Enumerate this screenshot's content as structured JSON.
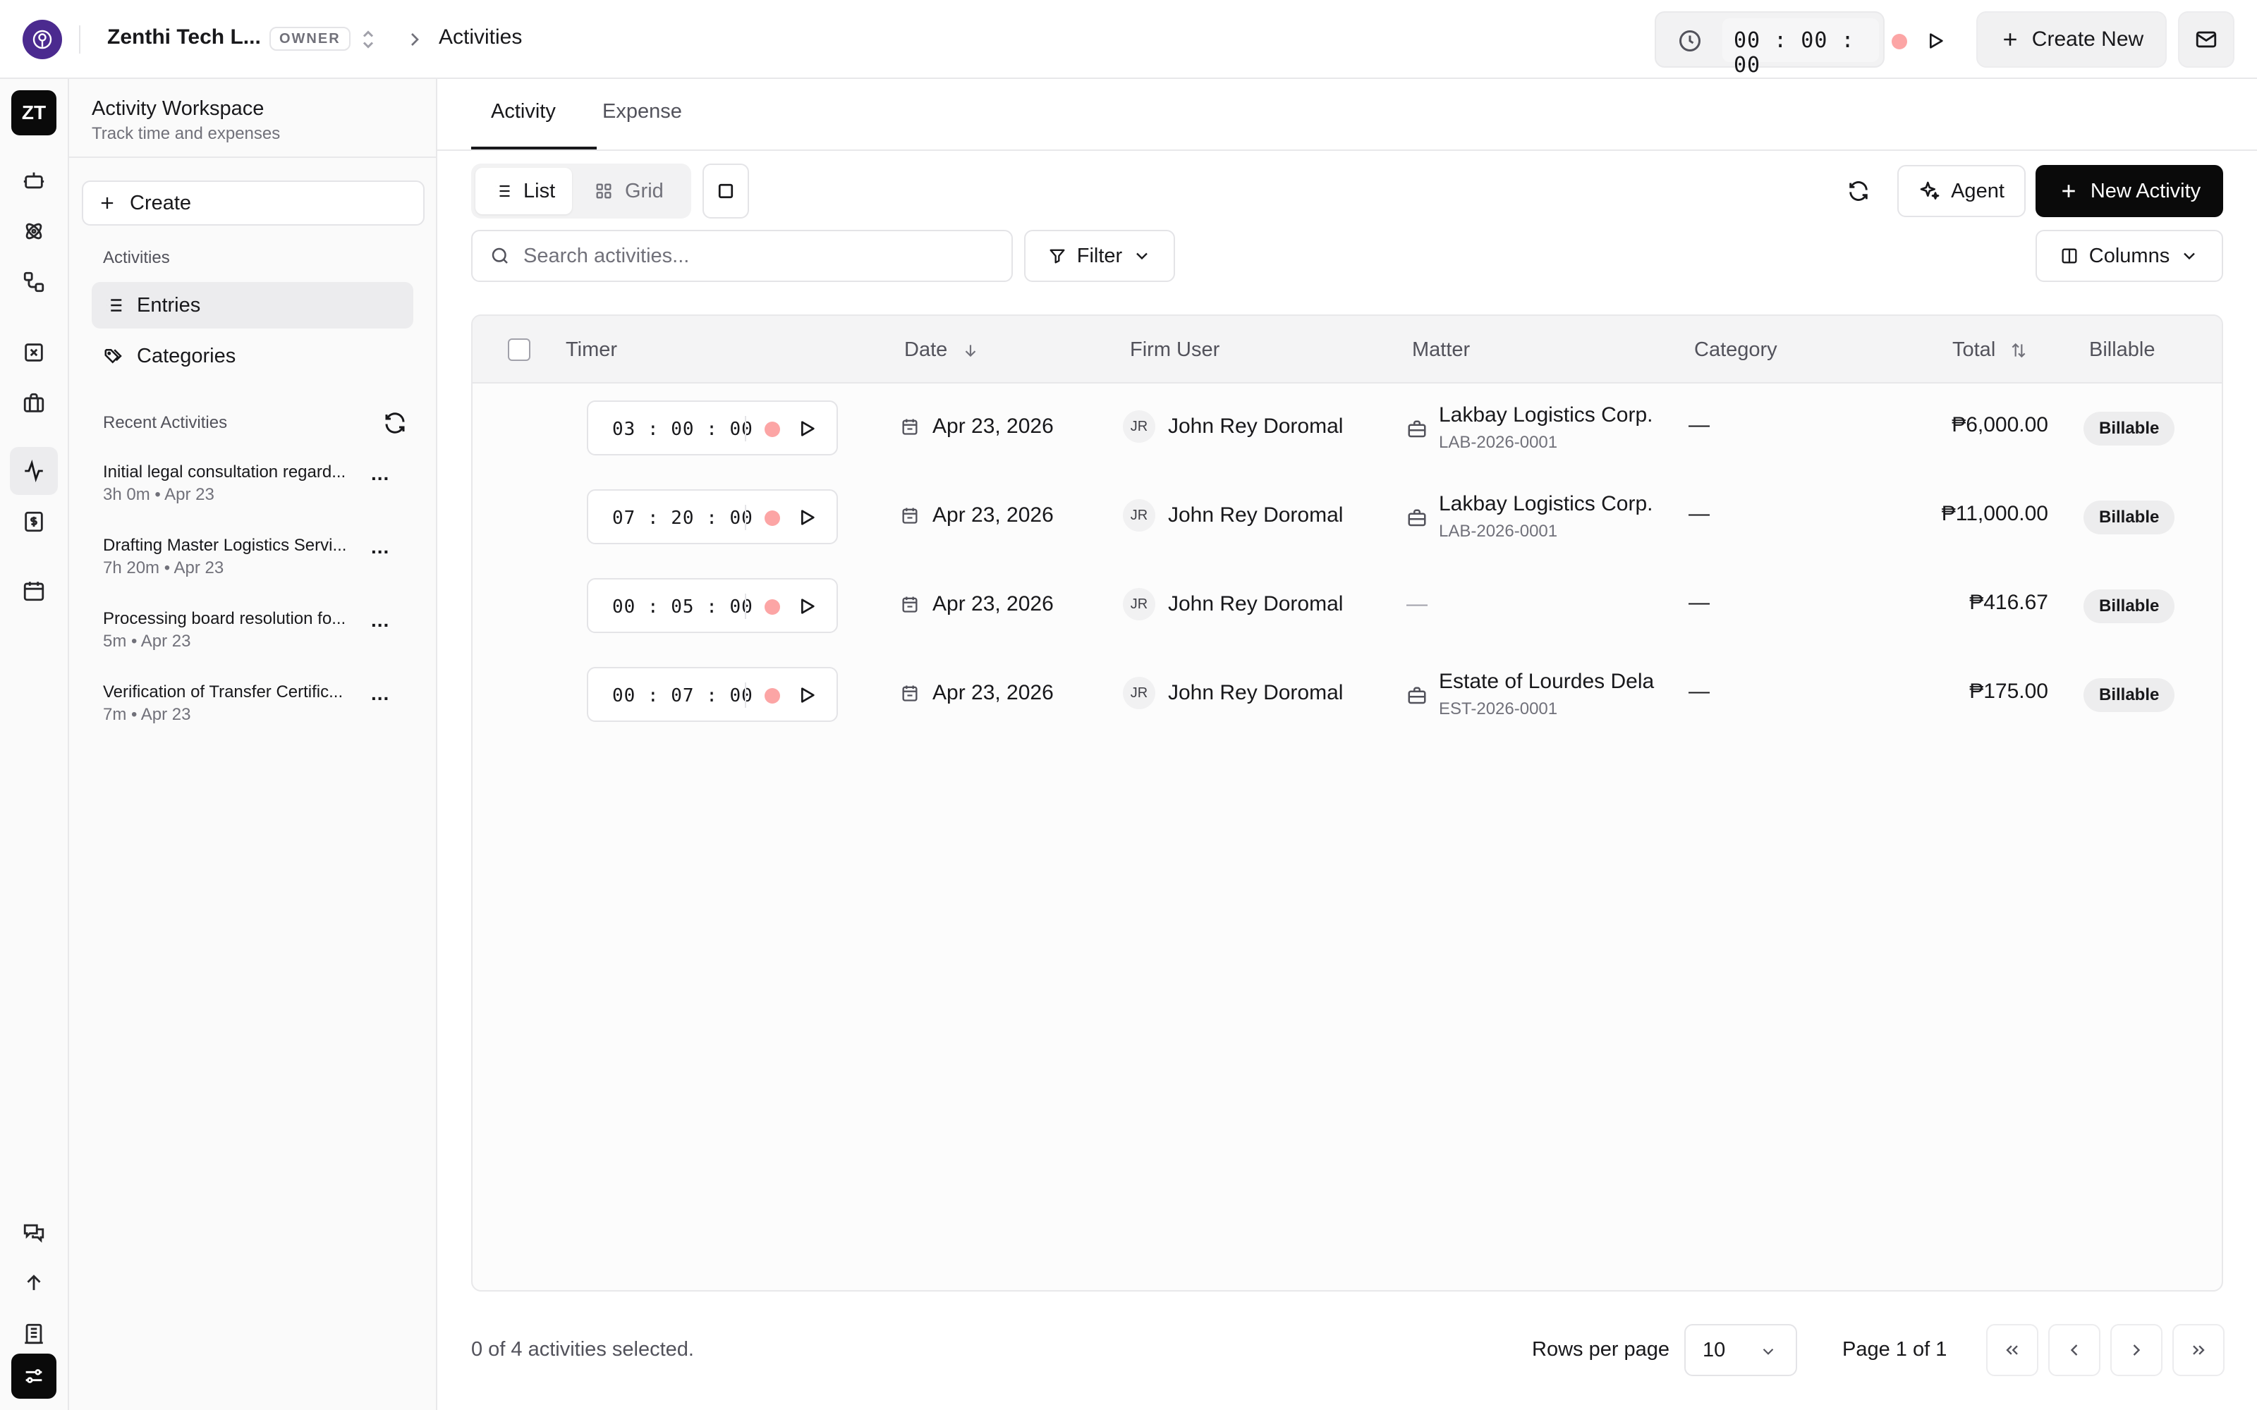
{
  "header": {
    "org_name": "Zenthi Tech L...",
    "role_badge": "OWNER",
    "breadcrumb_current": "Activities",
    "timer": "00 : 00 : 00",
    "create_new_label": "Create New"
  },
  "rail": {
    "avatar_initials": "ZT"
  },
  "sidepanel": {
    "title": "Activity Workspace",
    "subtitle": "Track time and expenses",
    "create_label": "Create",
    "section_activities": "Activities",
    "items": [
      {
        "label": "Entries",
        "icon": "list-icon",
        "active": true
      },
      {
        "label": "Categories",
        "icon": "tags-icon",
        "active": false
      }
    ],
    "section_recent": "Recent Activities",
    "recent": [
      {
        "title": "Initial legal consultation regard...",
        "meta": "3h 0m • Apr 23"
      },
      {
        "title": "Drafting Master Logistics Servi...",
        "meta": "7h 20m • Apr 23"
      },
      {
        "title": "Processing board resolution fo...",
        "meta": "5m • Apr 23"
      },
      {
        "title": "Verification of Transfer Certific...",
        "meta": "7m • Apr 23"
      }
    ],
    "more_label": "..."
  },
  "main": {
    "tabs": [
      {
        "label": "Activity",
        "active": true
      },
      {
        "label": "Expense",
        "active": false
      }
    ],
    "view_list": "List",
    "view_grid": "Grid",
    "agent_label": "Agent",
    "new_activity_label": "New Activity",
    "search_placeholder": "Search activities...",
    "filter_label": "Filter",
    "columns_label": "Columns"
  },
  "table": {
    "headers": {
      "timer": "Timer",
      "date": "Date",
      "firm_user": "Firm User",
      "matter": "Matter",
      "category": "Category",
      "total": "Total",
      "billable": "Billable"
    },
    "rows": [
      {
        "timer": "03 : 00 : 00",
        "date": "Apr 23, 2026",
        "user_initials": "JR",
        "user": "John Rey Doromal",
        "matter_name": "Lakbay Logistics Corp.",
        "matter_code": "LAB-2026-0001",
        "category": "—",
        "total": "₱6,000.00",
        "billable": "Billable"
      },
      {
        "timer": "07 : 20 : 00",
        "date": "Apr 23, 2026",
        "user_initials": "JR",
        "user": "John Rey Doromal",
        "matter_name": "Lakbay Logistics Corp.",
        "matter_code": "LAB-2026-0001",
        "category": "—",
        "total": "₱11,000.00",
        "billable": "Billable"
      },
      {
        "timer": "00 : 05 : 00",
        "date": "Apr 23, 2026",
        "user_initials": "JR",
        "user": "John Rey Doromal",
        "matter_name": "",
        "matter_code": "",
        "matter_empty": "—",
        "category": "—",
        "total": "₱416.67",
        "billable": "Billable"
      },
      {
        "timer": "00 : 07 : 00",
        "date": "Apr 23, 2026",
        "user_initials": "JR",
        "user": "John Rey Doromal",
        "matter_name": "Estate of Lourdes Dela",
        "matter_code": "EST-2026-0001",
        "category": "—",
        "total": "₱175.00",
        "billable": "Billable"
      }
    ]
  },
  "footer": {
    "selected": "0 of 4 activities selected.",
    "rows_per_page_label": "Rows per page",
    "rows_per_page_value": "10",
    "page_info": "Page 1 of 1"
  },
  "colors": {
    "brand": "#4b2a8f",
    "primary_button": "#0a0a0a",
    "record_dot": "#fca5a5"
  }
}
